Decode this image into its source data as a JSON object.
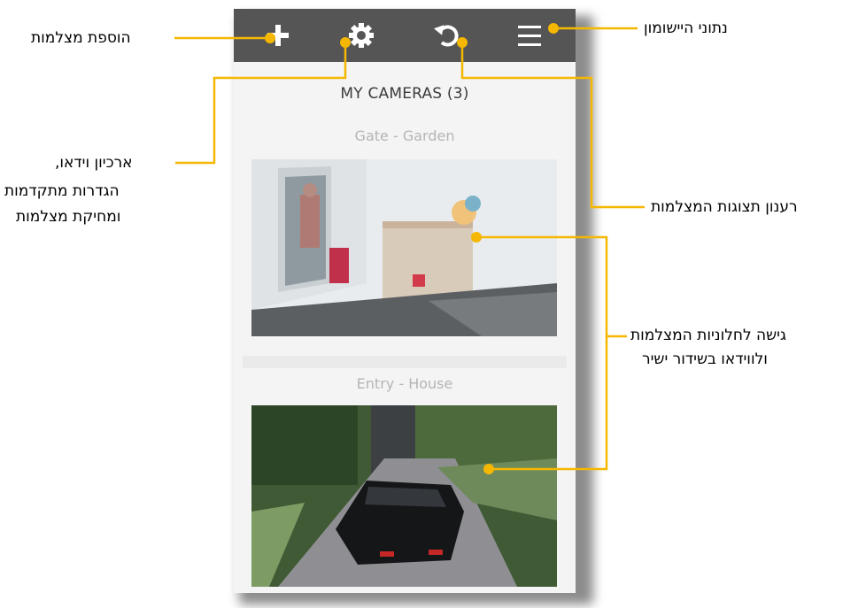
{
  "app": {
    "title": "MY CAMERAS (3)",
    "cameras": [
      {
        "label": "Gate - Garden"
      },
      {
        "label": "Entry - House"
      }
    ]
  },
  "toolbar": {
    "add_icon": "plus-icon",
    "settings_icon": "gear-icon",
    "refresh_icon": "refresh-icon",
    "menu_icon": "hamburger-menu-icon"
  },
  "annotations": {
    "add_cameras": "הוספת מצלמות",
    "app_info": "נתוני היישומון",
    "archive_line1": "ארכיון וידאו,",
    "archive_line2": "הגדרות מתקדמות",
    "archive_line3": "ומחיקת מצלמות",
    "refresh": "רענון תצוגות המצלמות",
    "access_line1": "גישה לחלוניות המצלמות",
    "access_line2": "ולווידאו בשידור ישיר"
  },
  "colors": {
    "accent": "#f5b700",
    "toolbar_bg": "#555555",
    "app_bg": "#f4f4f4"
  }
}
